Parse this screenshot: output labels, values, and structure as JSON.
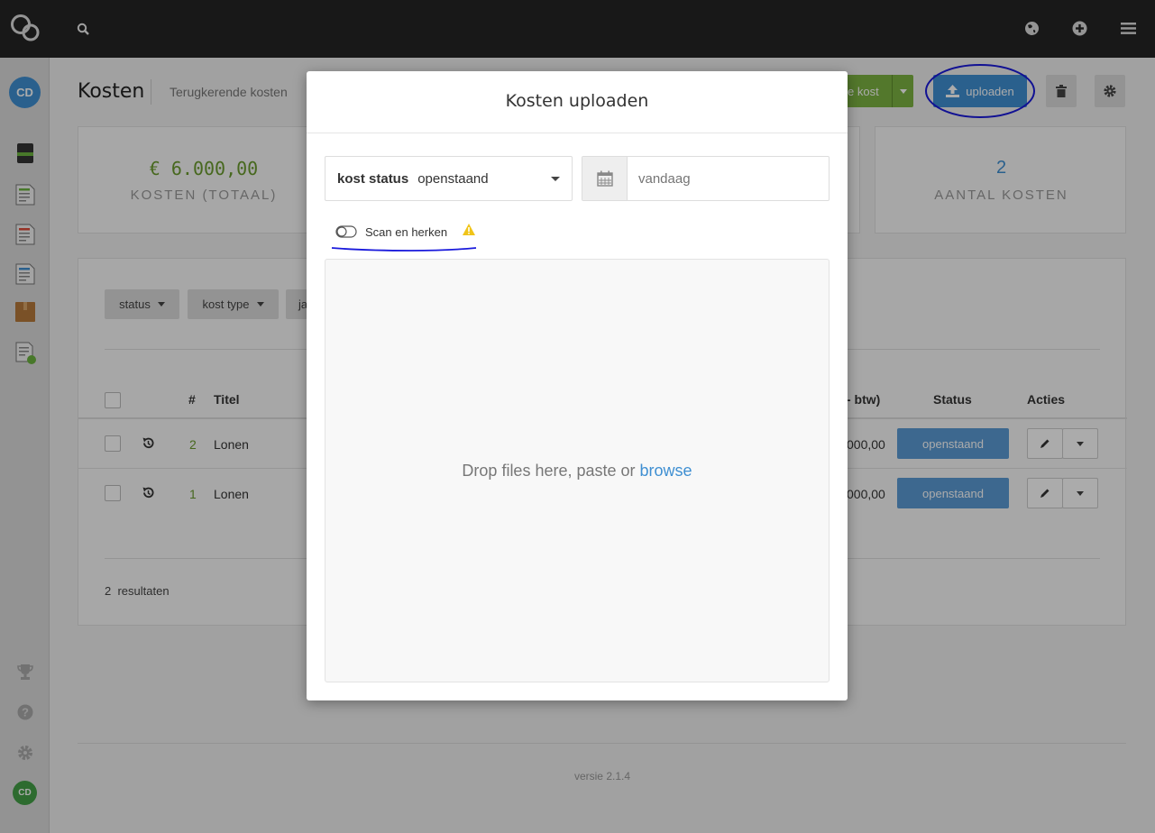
{
  "topbar": {
    "logo": "co-logo",
    "icons": [
      "search-icon",
      "globe-icon",
      "plus-circle-icon",
      "menu-icon"
    ]
  },
  "sidebar": {
    "avatar_top": "CD",
    "avatar_bottom": "CD",
    "items": [
      "notebook-icon",
      "invoice-green-icon",
      "invoice-red-icon",
      "invoice-blue-icon",
      "package-icon",
      "document-clock-icon"
    ],
    "bottom_items": [
      "trophy-icon",
      "help-icon",
      "settings-icon"
    ]
  },
  "header": {
    "title": "Kosten",
    "tab": "Terugkerende kosten",
    "new_label": "e kost",
    "upload_label": "uploaden"
  },
  "stats": {
    "total_value": "€ 6.000,00",
    "total_label": "KOSTEN (TOTAAL)",
    "count_value": "2",
    "count_label": "AANTAL KOSTEN"
  },
  "filters": {
    "status": "status",
    "type": "kost type",
    "third": "ja"
  },
  "table": {
    "headers": {
      "num": "#",
      "title": "Titel",
      "amount": "- btw)",
      "status": "Status",
      "actions": "Acties"
    },
    "rows": [
      {
        "num": "2",
        "title": "Lonen",
        "amount": "000,00",
        "status": "openstaand"
      },
      {
        "num": "1",
        "title": "Lonen",
        "amount": "000,00",
        "status": "openstaand"
      }
    ],
    "results_count": "2",
    "results_label": "resultaten"
  },
  "footer": {
    "version": "versie 2.1.4"
  },
  "modal": {
    "title": "Kosten uploaden",
    "status_label": "kost status",
    "status_value": "openstaand",
    "date_placeholder": "vandaag",
    "scan_label": "Scan en herken",
    "drop_text": "Drop files here, paste or ",
    "browse_label": "browse"
  },
  "colors": {
    "accent_blue": "#3f8fd2",
    "green": "#7cb342",
    "status_blue": "#5b9bd5",
    "annotation": "#1a1adc"
  }
}
